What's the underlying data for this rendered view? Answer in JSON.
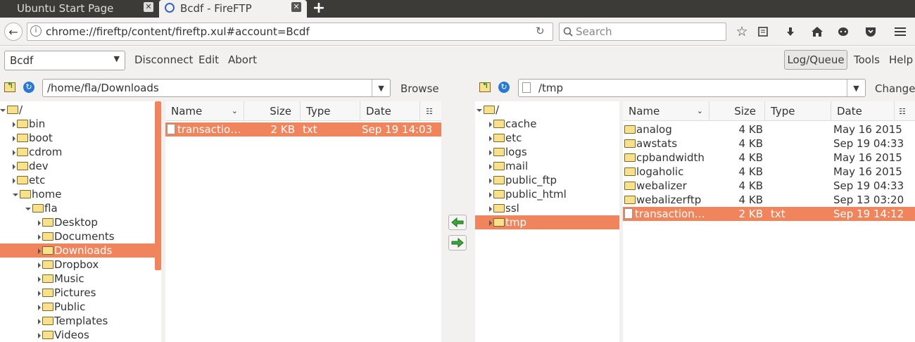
{
  "tabs": [
    {
      "title": "Ubuntu Start Page"
    },
    {
      "title": "Bcdf - FireFTP"
    }
  ],
  "new_tab_symbol": "+",
  "nav": {
    "url": "chrome://fireftp/content/fireftp.xul#account=Bcdf",
    "search_placeholder": "Search",
    "icons": [
      "back-icon",
      "info-icon",
      "reload-icon",
      "search-icon",
      "star-icon",
      "reading-list-icon",
      "download-icon",
      "home-icon",
      "chat-icon",
      "pocket-icon",
      "menu-icon"
    ]
  },
  "toolbar": {
    "account": "Bcdf",
    "disconnect": "Disconnect",
    "edit": "Edit",
    "abort": "Abort",
    "log_queue": "Log/Queue",
    "tools": "Tools",
    "help": "Help"
  },
  "local": {
    "path": "/home/fla/Downloads",
    "browse": "Browse",
    "tree": [
      {
        "label": "/",
        "depth": 0,
        "open": true
      },
      {
        "label": "bin",
        "depth": 1
      },
      {
        "label": "boot",
        "depth": 1
      },
      {
        "label": "cdrom",
        "depth": 1
      },
      {
        "label": "dev",
        "depth": 1
      },
      {
        "label": "etc",
        "depth": 1
      },
      {
        "label": "home",
        "depth": 1,
        "open": true
      },
      {
        "label": "fla",
        "depth": 2,
        "open": true
      },
      {
        "label": "Desktop",
        "depth": 3
      },
      {
        "label": "Documents",
        "depth": 3
      },
      {
        "label": "Downloads",
        "depth": 3,
        "selected": true
      },
      {
        "label": "Dropbox",
        "depth": 3
      },
      {
        "label": "Music",
        "depth": 3
      },
      {
        "label": "Pictures",
        "depth": 3
      },
      {
        "label": "Public",
        "depth": 3
      },
      {
        "label": "Templates",
        "depth": 3
      },
      {
        "label": "Videos",
        "depth": 3
      }
    ],
    "columns": [
      "Name",
      "Size",
      "Type",
      "Date"
    ],
    "files": [
      {
        "name": "transactio…",
        "size": "2 KB",
        "type": "txt",
        "date": "Sep 19 14:03",
        "kind": "file",
        "selected": true
      }
    ]
  },
  "remote": {
    "path": "/tmp",
    "change": "Change",
    "tree": [
      {
        "label": "/",
        "depth": 0,
        "open": true
      },
      {
        "label": "cache",
        "depth": 1
      },
      {
        "label": "etc",
        "depth": 1
      },
      {
        "label": "logs",
        "depth": 1
      },
      {
        "label": "mail",
        "depth": 1
      },
      {
        "label": "public_ftp",
        "depth": 1
      },
      {
        "label": "public_html",
        "depth": 1
      },
      {
        "label": "ssl",
        "depth": 1
      },
      {
        "label": "tmp",
        "depth": 1,
        "selected": true
      }
    ],
    "columns": [
      "Name",
      "Size",
      "Type",
      "Date"
    ],
    "files": [
      {
        "name": "analog",
        "size": "4 KB",
        "type": "",
        "date": "May 16 2015",
        "kind": "folder"
      },
      {
        "name": "awstats",
        "size": "4 KB",
        "type": "",
        "date": "Sep 19 04:33",
        "kind": "folder"
      },
      {
        "name": "cpbandwidth",
        "size": "4 KB",
        "type": "",
        "date": "May 16 2015",
        "kind": "folder"
      },
      {
        "name": "logaholic",
        "size": "4 KB",
        "type": "",
        "date": "May 16 2015",
        "kind": "folder"
      },
      {
        "name": "webalizer",
        "size": "4 KB",
        "type": "",
        "date": "Sep 19 04:33",
        "kind": "folder"
      },
      {
        "name": "webalizerftp",
        "size": "4 KB",
        "type": "",
        "date": "Sep 13 03:20",
        "kind": "folder"
      },
      {
        "name": "transactions…",
        "size": "2 KB",
        "type": "txt",
        "date": "Sep 19 14:12",
        "kind": "file",
        "selected": true
      }
    ]
  },
  "colors": {
    "selection": "#f0855d",
    "chrome_dark": "#3c3b37",
    "toolbar": "#f2f1f0"
  }
}
